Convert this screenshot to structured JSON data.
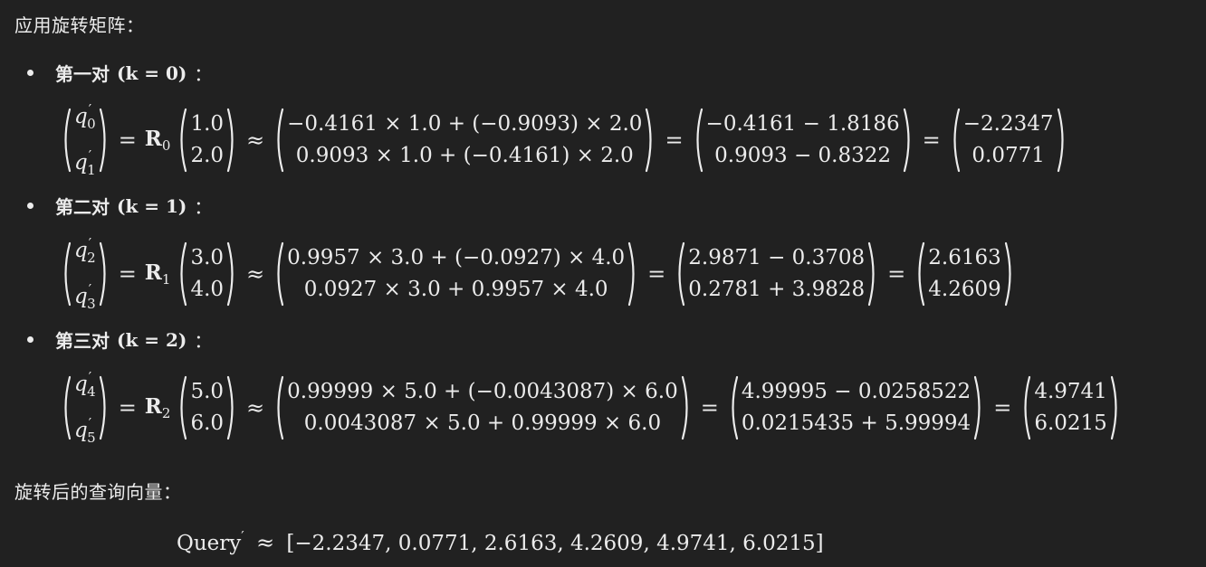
{
  "intro_heading": "应用旋转矩阵：",
  "pairs": [
    {
      "label": "第一对",
      "k_expr": "(k = 0)",
      "colon": "：",
      "lhs_top_sub": "0",
      "lhs_bottom_sub": "1",
      "R_sub": "0",
      "input": [
        "1.0",
        "2.0"
      ],
      "expanded": [
        "−0.4161 × 1.0 + (−0.9093) × 2.0",
        "0.9093 × 1.0 + (−0.4161) × 2.0"
      ],
      "simplified": [
        "−0.4161 − 1.8186",
        "0.9093 − 0.8322"
      ],
      "result": [
        "−2.2347",
        "0.0771"
      ]
    },
    {
      "label": "第二对",
      "k_expr": "(k = 1)",
      "colon": "：",
      "lhs_top_sub": "2",
      "lhs_bottom_sub": "3",
      "R_sub": "1",
      "input": [
        "3.0",
        "4.0"
      ],
      "expanded": [
        "0.9957 × 3.0 + (−0.0927) × 4.0",
        "0.0927 × 3.0 + 0.9957 × 4.0"
      ],
      "simplified": [
        "2.9871 − 0.3708",
        "0.2781 + 3.9828"
      ],
      "result": [
        "2.6163",
        "4.2609"
      ]
    },
    {
      "label": "第三对",
      "k_expr": "(k = 2)",
      "colon": "：",
      "lhs_top_sub": "4",
      "lhs_bottom_sub": "5",
      "R_sub": "2",
      "input": [
        "5.0",
        "6.0"
      ],
      "expanded": [
        "0.99999 × 5.0 + (−0.0043087) × 6.0",
        "0.0043087 × 5.0 + 0.99999 × 6.0"
      ],
      "simplified": [
        "4.99995 − 0.0258522",
        "0.0215435 + 5.99994"
      ],
      "result": [
        "4.9741",
        "6.0215"
      ]
    }
  ],
  "symbols": {
    "q": "q",
    "prime": "′",
    "equals": "=",
    "approx": "≈",
    "R": "R"
  },
  "result_heading": "旋转后的查询向量：",
  "final": {
    "lhs": "Query",
    "prime": "′",
    "approx": "≈",
    "vector": "[−2.2347, 0.0771, 2.6163, 4.2609, 4.9741, 6.0215]"
  }
}
